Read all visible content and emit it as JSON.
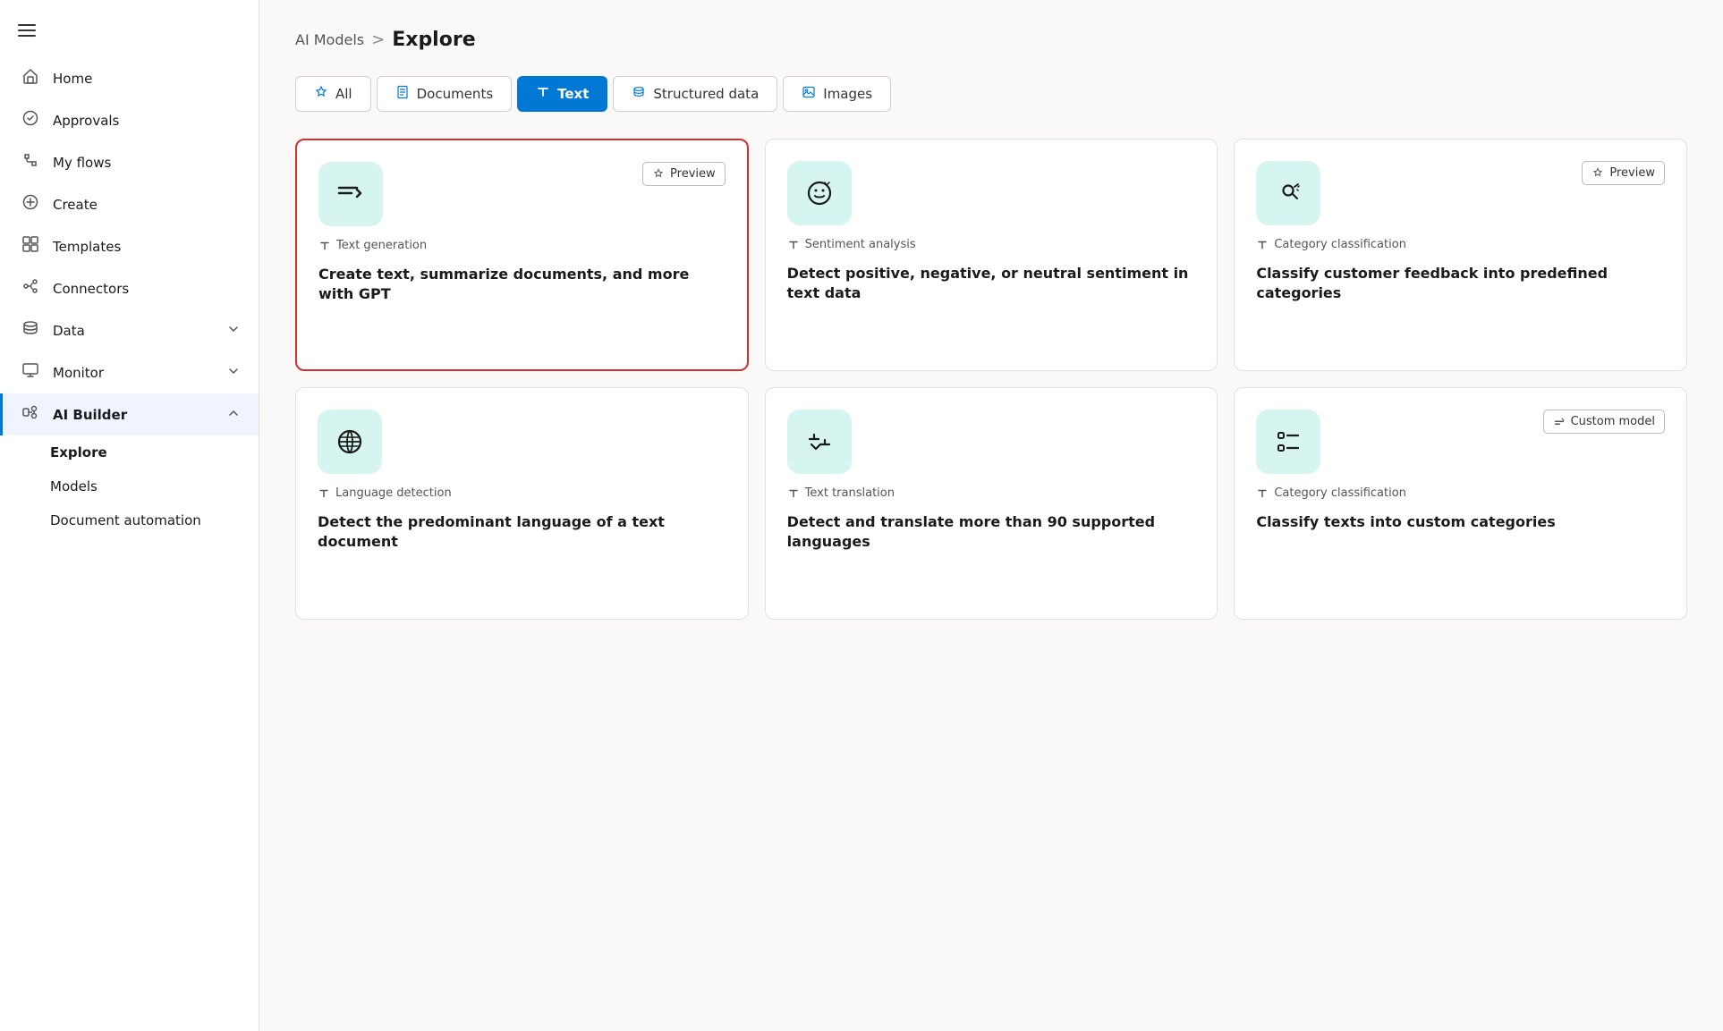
{
  "sidebar": {
    "items": [
      {
        "id": "home",
        "label": "Home",
        "icon": "home"
      },
      {
        "id": "approvals",
        "label": "Approvals",
        "icon": "approvals"
      },
      {
        "id": "my-flows",
        "label": "My flows",
        "icon": "flows"
      },
      {
        "id": "create",
        "label": "Create",
        "icon": "create"
      },
      {
        "id": "templates",
        "label": "Templates",
        "icon": "templates"
      },
      {
        "id": "connectors",
        "label": "Connectors",
        "icon": "connectors"
      },
      {
        "id": "data",
        "label": "Data",
        "icon": "data",
        "hasChevron": true
      },
      {
        "id": "monitor",
        "label": "Monitor",
        "icon": "monitor",
        "hasChevron": true
      },
      {
        "id": "ai-builder",
        "label": "AI Builder",
        "icon": "ai-builder",
        "hasChevron": true,
        "active": true
      }
    ],
    "sub_items": [
      {
        "id": "explore",
        "label": "Explore",
        "active": true
      },
      {
        "id": "models",
        "label": "Models"
      },
      {
        "id": "document-automation",
        "label": "Document automation"
      }
    ]
  },
  "breadcrumb": {
    "parent": "AI Models",
    "separator": ">",
    "current": "Explore"
  },
  "tabs": [
    {
      "id": "all",
      "label": "All",
      "icon": "star",
      "active": false
    },
    {
      "id": "documents",
      "label": "Documents",
      "icon": "document",
      "active": false
    },
    {
      "id": "text",
      "label": "Text",
      "icon": "text-t",
      "active": true
    },
    {
      "id": "structured-data",
      "label": "Structured data",
      "icon": "database",
      "active": false
    },
    {
      "id": "images",
      "label": "Images",
      "icon": "image",
      "active": false
    }
  ],
  "cards": [
    {
      "id": "text-generation",
      "type_label": "Text generation",
      "title": "Create text, summarize documents, and more with GPT",
      "badge": "Preview",
      "icon": "text-gen",
      "highlighted": true
    },
    {
      "id": "sentiment-analysis",
      "type_label": "Sentiment analysis",
      "title": "Detect positive, negative, or neutral sentiment in text data",
      "badge": null,
      "icon": "sentiment",
      "highlighted": false
    },
    {
      "id": "category-classification",
      "type_label": "Category classification",
      "title": "Classify customer feedback into predefined categories",
      "badge": "Preview",
      "icon": "category",
      "highlighted": false
    },
    {
      "id": "language-detection",
      "type_label": "Language detection",
      "title": "Detect the predominant language of a text document",
      "badge": null,
      "icon": "language",
      "highlighted": false
    },
    {
      "id": "text-translation",
      "type_label": "Text translation",
      "title": "Detect and translate more than 90 supported languages",
      "badge": null,
      "icon": "translation",
      "highlighted": false
    },
    {
      "id": "category-classification-custom",
      "type_label": "Category classification",
      "title": "Classify texts into custom categories",
      "badge": "Custom model",
      "icon": "custom-category",
      "highlighted": false
    }
  ],
  "labels": {
    "preview": "Preview",
    "custom_model": "Custom model"
  }
}
